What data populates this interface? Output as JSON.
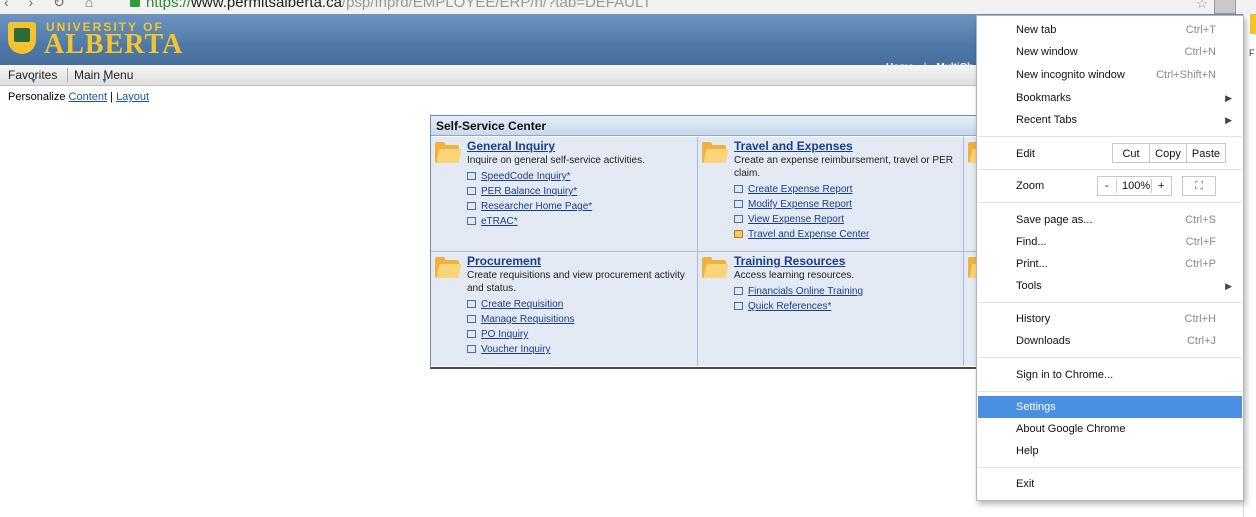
{
  "browser": {
    "url_scheme": "https://",
    "url_host": "www.permitsalberta.ca",
    "url_path": "/psp/fnprd/EMPLOYEE/ERP/h/?tab=DEFAULT"
  },
  "header": {
    "university_line": "UNIVERSITY OF",
    "name_line": "ALBERTA",
    "home_link": "Home",
    "separator": "|",
    "multichannel_link": "MultiCh"
  },
  "nav": {
    "favorites": "Favorites",
    "main_menu": "Main Menu"
  },
  "personalize": {
    "label": "Personalize",
    "content": "Content",
    "separator": "|",
    "layout": "Layout"
  },
  "pagelet": {
    "title": "Self-Service Center",
    "categories": [
      {
        "title": "General Inquiry",
        "description": "Inquire on general self-service activities.",
        "links": [
          "SpeedCode Inquiry*",
          "PER Balance Inquiry*",
          "Researcher Home Page*",
          "eTRAC*"
        ]
      },
      {
        "title": "Travel and Expenses",
        "description": "Create an expense reimbursement, travel or PER claim.",
        "links": [
          "Create Expense Report",
          "Modify Expense Report",
          "View Expense Report",
          "Travel and Expense Center"
        ]
      },
      {
        "title": "Procurement",
        "description": "Create requisitions and view procurement activity and status.",
        "links": [
          "Create Requisition",
          "Manage Requisitions",
          "PO Inquiry",
          "Voucher Inquiry"
        ]
      },
      {
        "title": "Training Resources",
        "description": "Access learning resources.",
        "links": [
          "Financials Online Training",
          "Quick References*"
        ]
      }
    ]
  },
  "chrome_menu": {
    "new_tab": {
      "label": "New tab",
      "shortcut": "Ctrl+T"
    },
    "new_window": {
      "label": "New window",
      "shortcut": "Ctrl+N"
    },
    "new_incognito": {
      "label": "New incognito window",
      "shortcut": "Ctrl+Shift+N"
    },
    "bookmarks": {
      "label": "Bookmarks"
    },
    "recent_tabs": {
      "label": "Recent Tabs"
    },
    "edit": {
      "label": "Edit",
      "cut": "Cut",
      "copy": "Copy",
      "paste": "Paste"
    },
    "zoom": {
      "label": "Zoom",
      "minus": "-",
      "level": "100%",
      "plus": "+"
    },
    "save_page": {
      "label": "Save page as...",
      "shortcut": "Ctrl+S"
    },
    "find": {
      "label": "Find...",
      "shortcut": "Ctrl+F"
    },
    "print": {
      "label": "Print...",
      "shortcut": "Ctrl+P"
    },
    "tools": {
      "label": "Tools"
    },
    "history": {
      "label": "History",
      "shortcut": "Ctrl+H"
    },
    "downloads": {
      "label": "Downloads",
      "shortcut": "Ctrl+J"
    },
    "sign_in": {
      "label": "Sign in to Chrome..."
    },
    "settings": {
      "label": "Settings"
    },
    "about": {
      "label": "About Google Chrome"
    },
    "help": {
      "label": "Help"
    },
    "exit": {
      "label": "Exit"
    }
  },
  "colors": {
    "header_blue": "#4f7aa8",
    "logo_gold": "#f4c430",
    "link_blue": "#1a3d8a",
    "menu_highlight": "#4a90e2"
  }
}
